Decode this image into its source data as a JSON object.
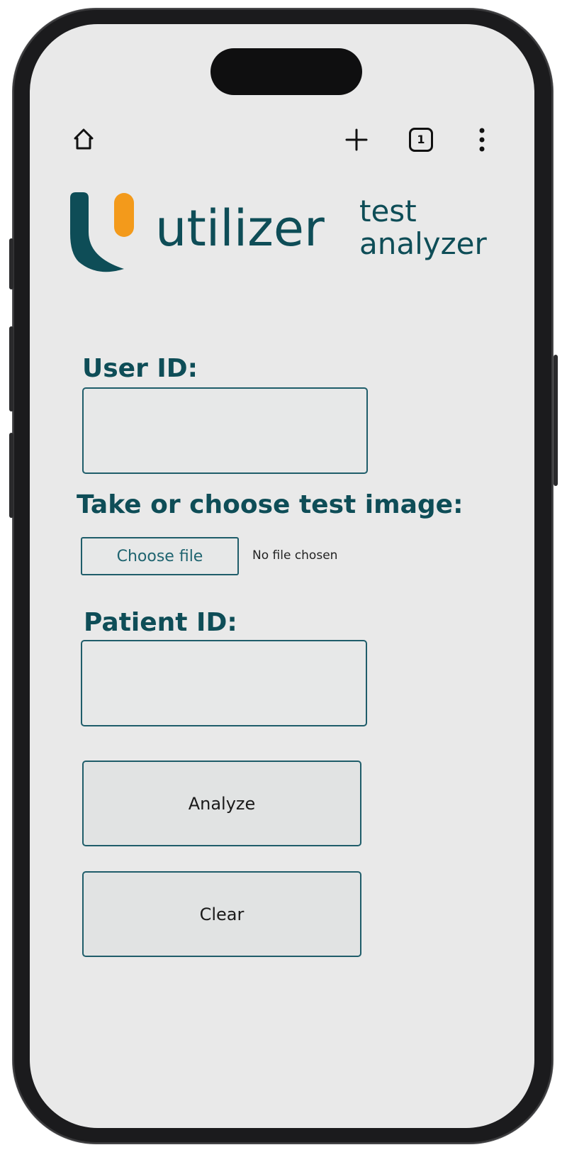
{
  "browser_toolbar": {
    "home_icon": "home-icon",
    "new_tab_icon": "plus-icon",
    "tab_count": "1",
    "menu_icon": "more-vertical-icon"
  },
  "brand": {
    "wordmark": "utilizer",
    "subtitle": "test\nanalyzer",
    "colors": {
      "primary": "#0e4d57",
      "accent": "#f39a1b"
    }
  },
  "form": {
    "user_id_label": "User ID:",
    "user_id_value": "",
    "image_label": "Take or choose test image:",
    "choose_file_label": "Choose file",
    "file_status": "No file chosen",
    "patient_id_label": "Patient ID:",
    "patient_id_value": "",
    "analyze_label": "Analyze",
    "clear_label": "Clear"
  }
}
